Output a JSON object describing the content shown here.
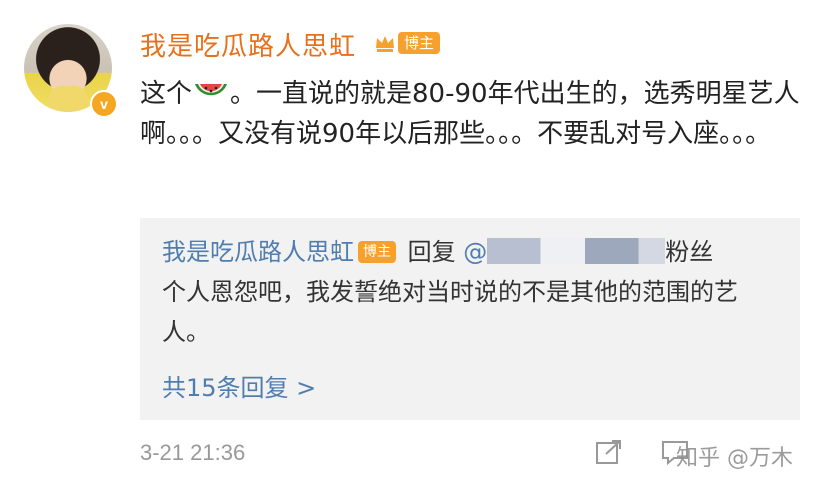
{
  "post": {
    "author": "我是吃瓜路人思虹",
    "author_badge": "博主",
    "verify_mark": "v",
    "text_part1": "这个",
    "text_part2": "。一直说的就是80-90年代出生的，选秀明星艺人啊。。。又没有说90年以后那些。。。不要乱对号入座。。。",
    "timestamp": "3-21 21:36"
  },
  "reply": {
    "author": "我是吃瓜路人思虹",
    "author_badge": "博主",
    "verb": " 回复 ",
    "mention_prefix": "@",
    "mention_suffix": "粉丝",
    "text": "个人恩怨吧，我发誓绝对当时说的不是其他的范围的艺人。",
    "more_label": "共15条回复 >"
  },
  "icons": {
    "melon": "watermelon-emoji-icon",
    "crown": "crown-icon",
    "share": "share-icon",
    "comment": "comment-icon"
  },
  "watermark": "知乎 @万木",
  "colors": {
    "author": "#e8701a",
    "link": "#507daf",
    "badge": "#f6a12d",
    "reply_bg": "#f2f2f2",
    "muted": "#999999"
  }
}
